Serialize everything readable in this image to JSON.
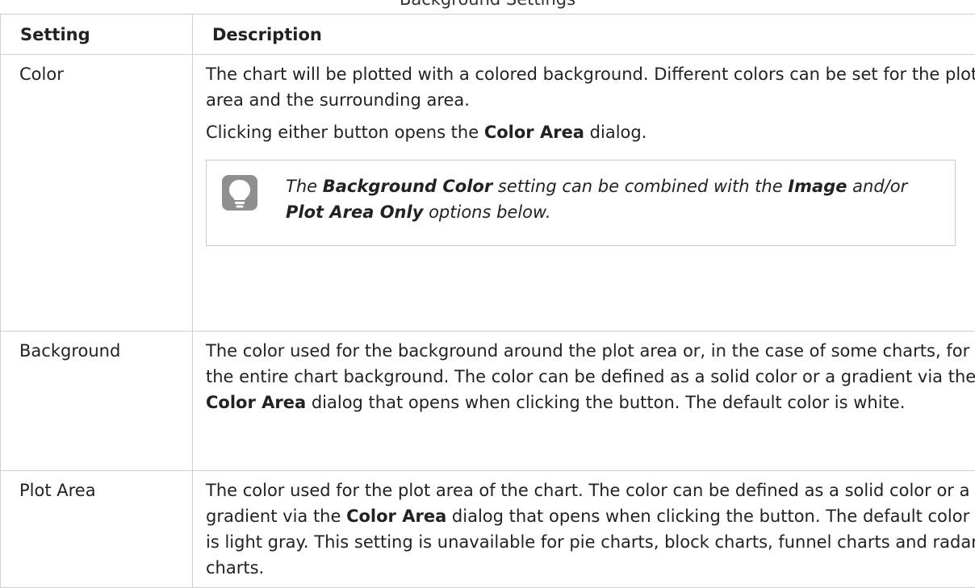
{
  "caption": "Background Settings",
  "table": {
    "headers": [
      "Setting",
      "Description"
    ],
    "rows": [
      {
        "setting": "Color",
        "p1": "The chart will be plotted with a colored background. Different colors can be set for the plot area and the surrounding area.",
        "p2": {
          "pre": "Clicking either button opens the ",
          "bold": "Color Area",
          "post": " dialog."
        },
        "tip": {
          "icon": "lightbulb-icon",
          "t1": "The ",
          "b1": "Background Color",
          "t2": " setting can be combined with the ",
          "b2": "Image",
          "t3": " and/or ",
          "b3": "Plot Area Only",
          "t4": " options below."
        }
      },
      {
        "setting": "Background",
        "pre": "The color used for the background around the plot area or, in the case of some charts, for the entire chart background. The color can be defined as a solid color or a gradient via the ",
        "bold": "Color Area",
        "post": " dialog that opens when clicking the button. The default color is white."
      },
      {
        "setting": "Plot Area",
        "pre": "The color used for the plot area of the chart. The color can be defined as a solid color or a gradient via the ",
        "bold": "Color Area",
        "post": " dialog that opens when clicking the button. The default color is light gray. This setting is unavailable for pie charts, block charts, funnel charts and radar charts."
      }
    ]
  }
}
